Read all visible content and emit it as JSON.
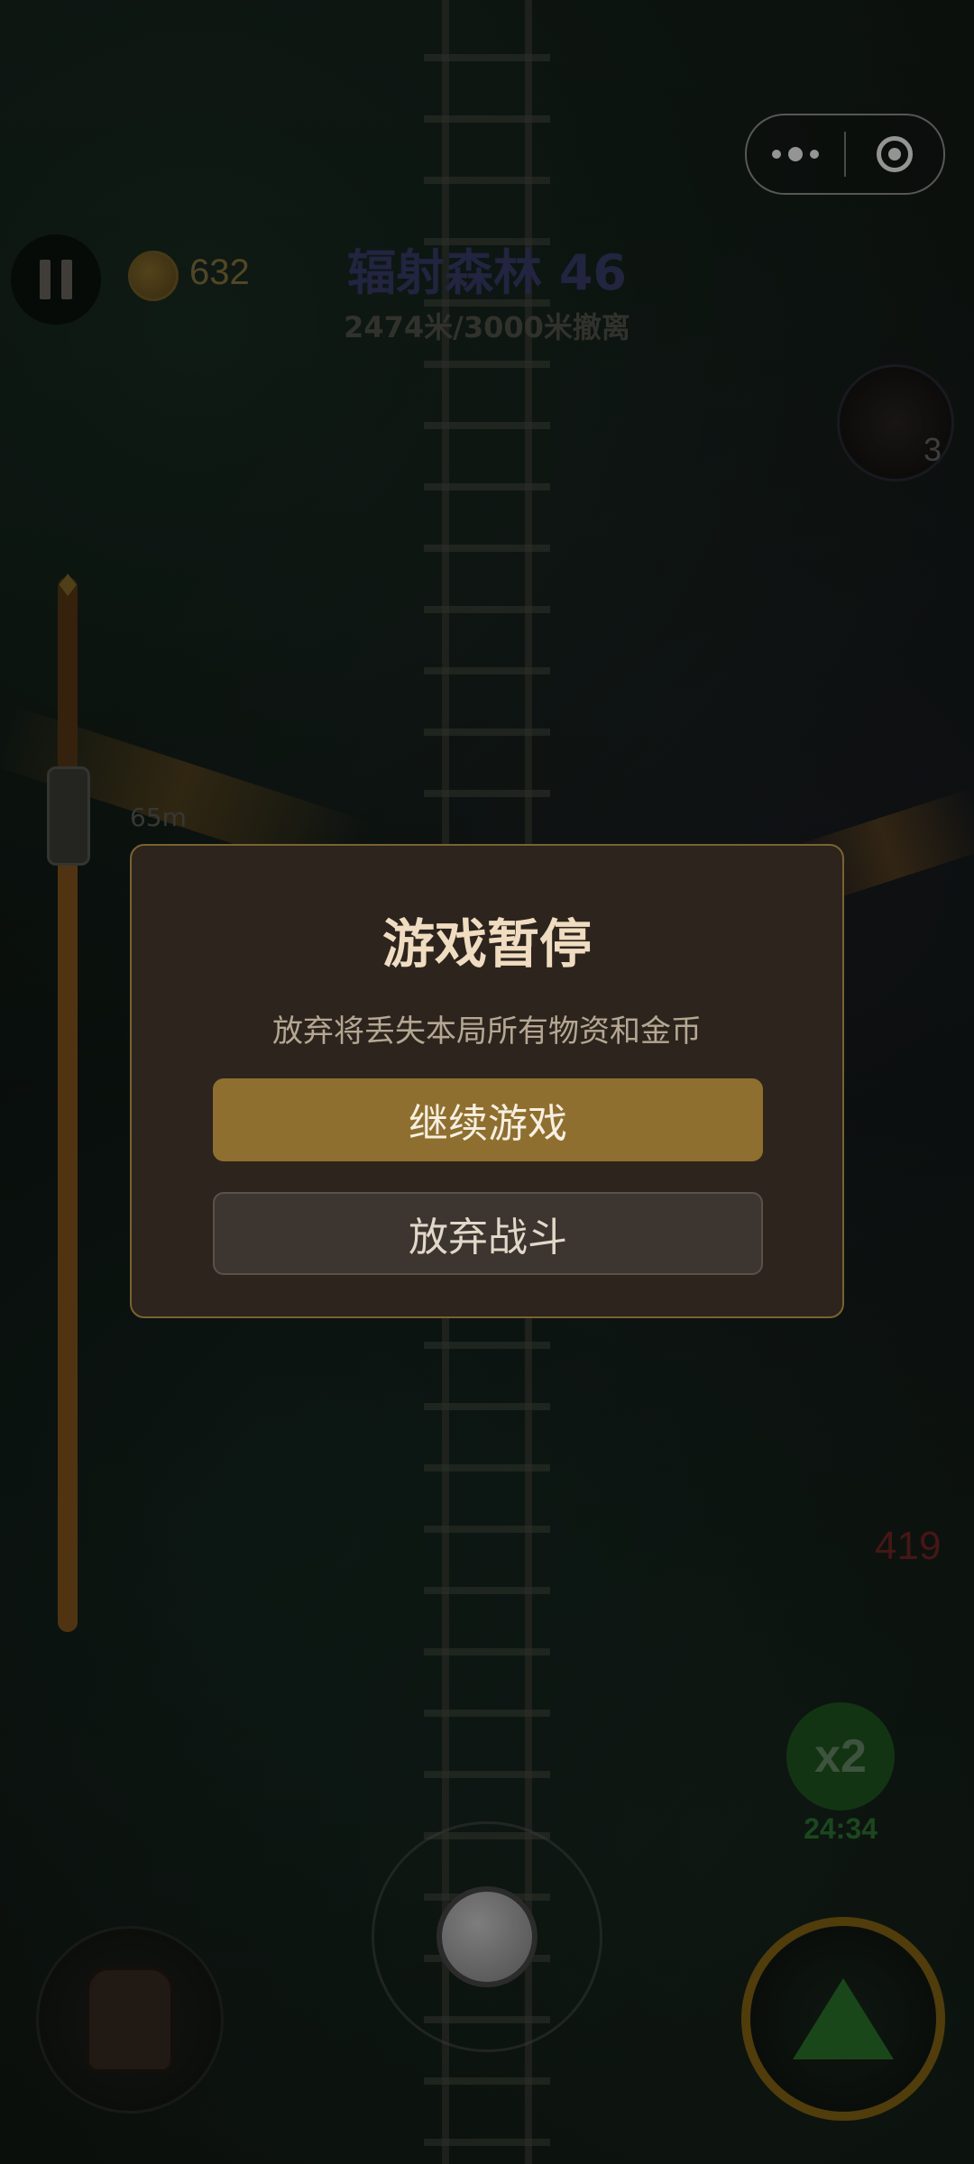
{
  "hud": {
    "coins": "632",
    "stage_title": "辐射森林 46",
    "distance_progress": "2474米/3000米撤离",
    "skill_count": "3",
    "distance_marker": "65m",
    "enemy_value": "419",
    "speed_multiplier": "x2",
    "boost_timer": "24:34",
    "evac_progress": 0.82
  },
  "dialog": {
    "title": "游戏暂停",
    "warning": "放弃将丢失本局所有物资和金币",
    "continue_label": "继续游戏",
    "quit_label": "放弃战斗"
  },
  "icons": {
    "pause": "pause-icon",
    "coin": "coin-icon",
    "menu": "more-dots-icon",
    "close": "target-circle-icon",
    "skill": "weapon-skill-icon",
    "train": "train-icon",
    "bag": "backpack-icon",
    "boost": "arrow-up-boost-icon"
  },
  "colors": {
    "dialog_bg": "#2c241d",
    "continue_button": "#8f6f2f",
    "quit_button": "#3d3530",
    "title_text": "#f0dcc0"
  }
}
